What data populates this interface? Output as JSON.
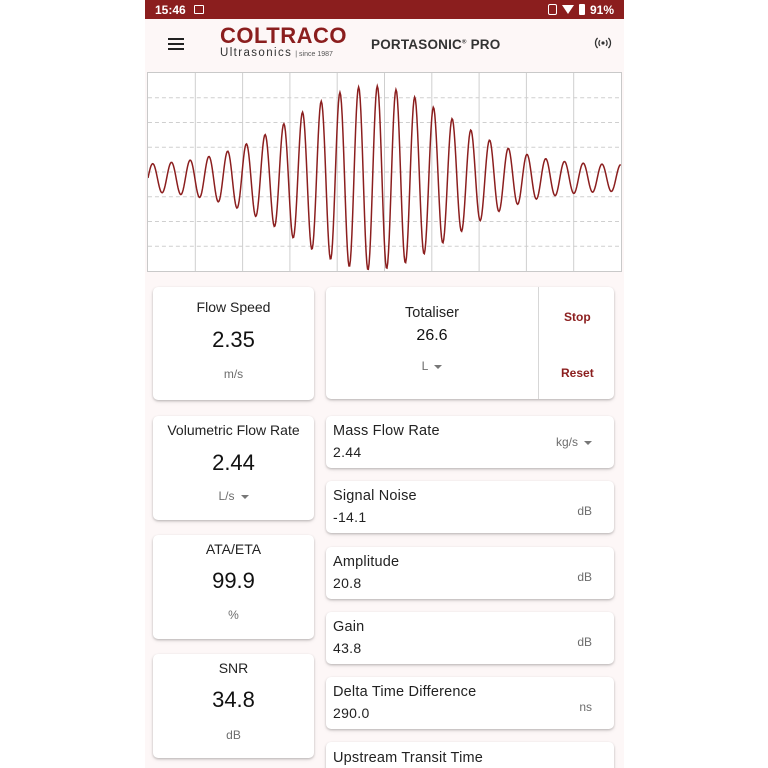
{
  "status_bar": {
    "time": "15:46",
    "battery": "91%"
  },
  "header": {
    "brand": "COLTRACO",
    "brand_sub": "Ultrasonics",
    "brand_since": "| since 1987",
    "product_main": "PORTASONIC",
    "product_reg": "®",
    "product_suffix": " PRO"
  },
  "tiles": {
    "flow_speed": {
      "label": "Flow Speed",
      "value": "2.35",
      "unit": "m/s"
    },
    "volumetric": {
      "label": "Volumetric Flow Rate",
      "value": "2.44",
      "unit": "L/s"
    },
    "ata_eta": {
      "label": "ATA/ETA",
      "value": "99.9",
      "unit": "%"
    },
    "snr": {
      "label": "SNR",
      "value": "34.8",
      "unit": "dB"
    }
  },
  "totaliser": {
    "label": "Totaliser",
    "value": "26.6",
    "unit": "L",
    "stop_label": "Stop",
    "reset_label": "Reset"
  },
  "rows": [
    {
      "label": "Mass Flow Rate",
      "value": "2.44",
      "unit": "kg/s"
    },
    {
      "label": "Signal Noise",
      "value": "-14.1",
      "unit": "dB"
    },
    {
      "label": "Amplitude",
      "value": "20.8",
      "unit": "dB"
    },
    {
      "label": "Gain",
      "value": "43.8",
      "unit": "dB"
    },
    {
      "label": "Delta Time Difference",
      "value": "290.0",
      "unit": "ns"
    },
    {
      "label": "Upstream Transit Time",
      "value": "",
      "unit": ""
    }
  ],
  "colors": {
    "accent": "#8b1e1e",
    "waveform": "#8b1e1e",
    "grid": "#cfcfcf"
  },
  "icons": {
    "menu": "menu-icon",
    "signal": "signal-broadcast-icon"
  }
}
